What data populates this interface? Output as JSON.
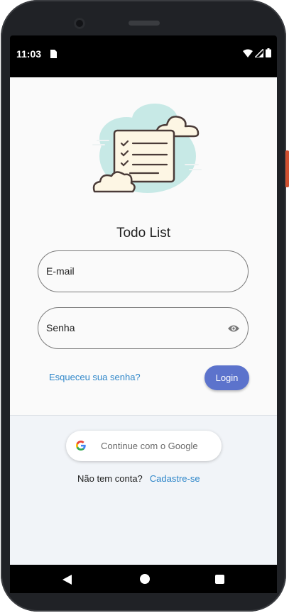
{
  "status_bar": {
    "time": "11:03"
  },
  "app": {
    "title": "Todo List"
  },
  "email_field": {
    "label": "E-mail"
  },
  "password_field": {
    "label": "Senha"
  },
  "forgot_link": "Esqueceu sua senha?",
  "login_button": "Login",
  "google_button": "Continue com o Google",
  "signup": {
    "prompt": "Não tem conta?",
    "link": "Cadastre-se"
  },
  "colors": {
    "primary": "#5c73cc",
    "link": "#2e86c9",
    "cloud": "#c7e9e6"
  },
  "icons": [
    "sim-card-icon",
    "wifi-icon",
    "signal-icon",
    "battery-icon",
    "eye-icon",
    "google-icon",
    "nav-back-icon",
    "nav-home-icon",
    "nav-recent-icon"
  ]
}
